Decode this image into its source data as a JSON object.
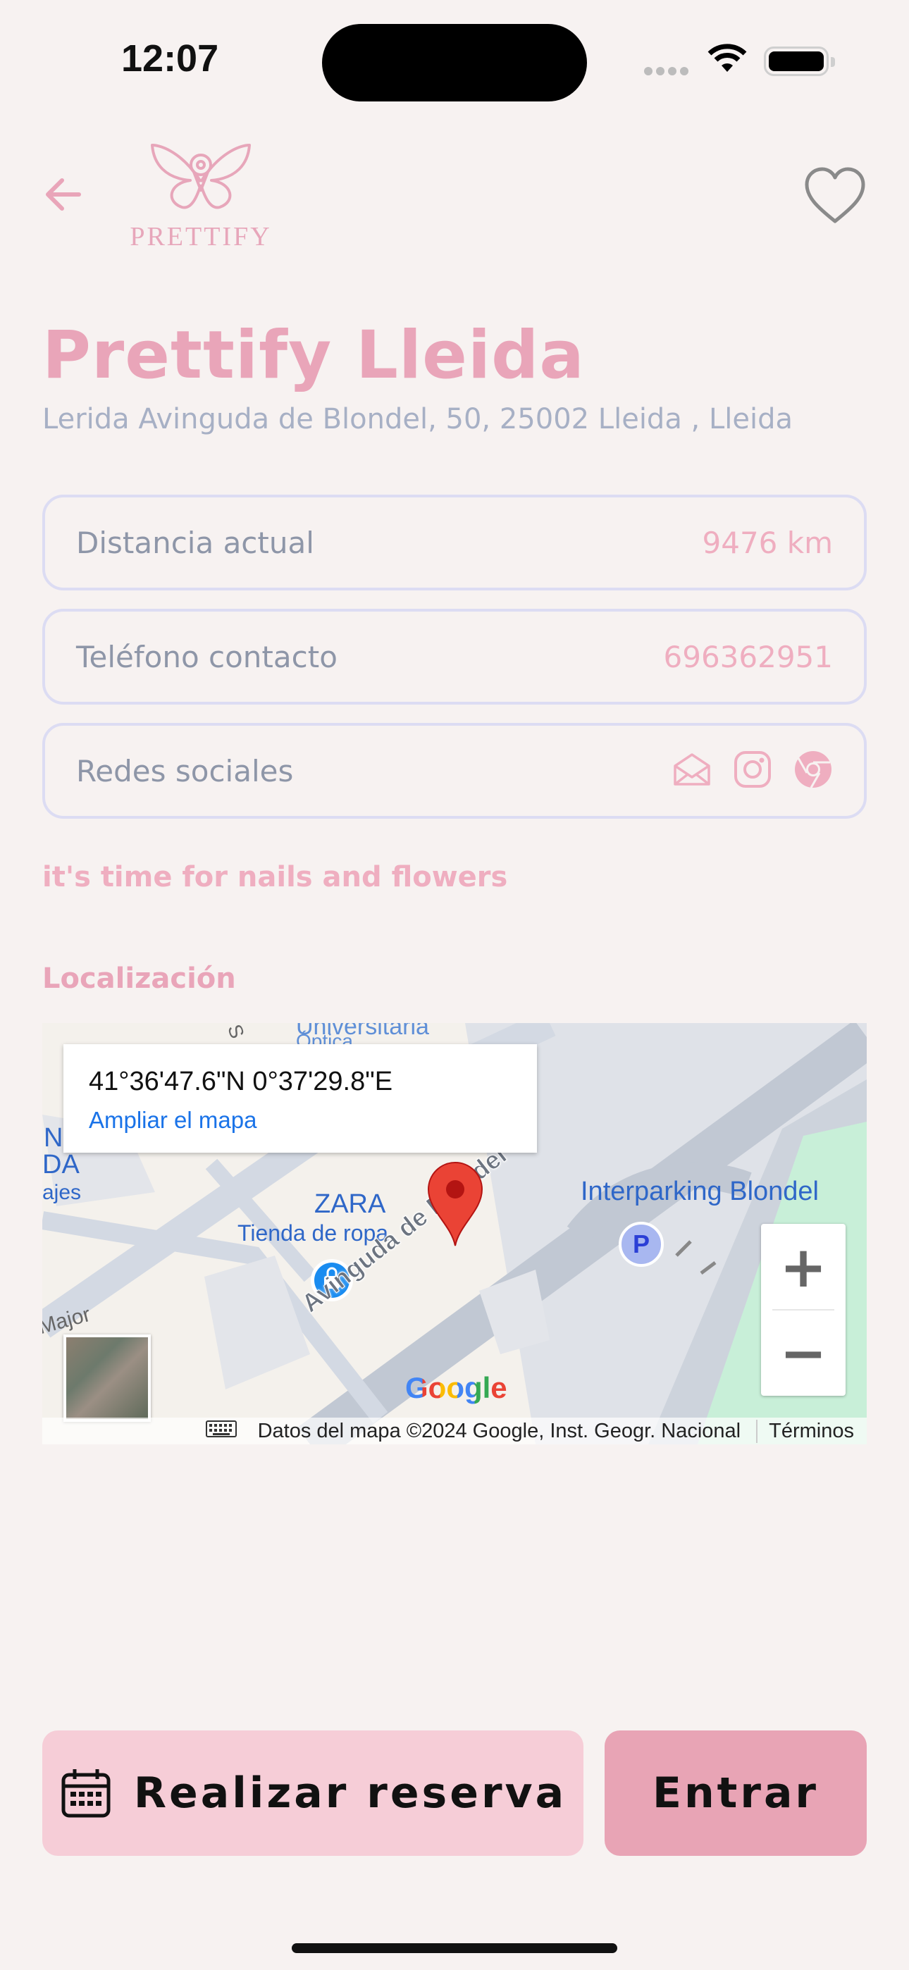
{
  "status_bar": {
    "time": "12:07"
  },
  "header": {
    "brand": "PRETTIFY"
  },
  "place": {
    "name": "Prettify Lleida",
    "address": "Lerida Avinguda de Blondel, 50, 25002 Lleida , Lleida"
  },
  "info": {
    "distance_label": "Distancia actual",
    "distance_value": "9476 km",
    "phone_label": "Teléfono contacto",
    "phone_value": "696362951",
    "social_label": "Redes sociales"
  },
  "tagline": "it's time for nails and flowers",
  "location_title": "Localización",
  "map": {
    "coords": "41°36'47.6\"N 0°37'29.8\"E",
    "enlarge_link": "Ampliar el mapa",
    "place_zara": "ZARA",
    "place_zara_sub": "Tienda de ropa",
    "place_parking": "Interparking Blondel",
    "street": "Avinguda de Blondel",
    "label_univ": "Universitària",
    "label_optica": "Óptica",
    "label_n": "N",
    "label_da": "DA",
    "label_ajes": "ajes",
    "label_major": "Major",
    "label_s": "S",
    "google": "Google",
    "attribution": "Datos del mapa ©2024 Google, Inst. Geogr. Nacional",
    "terms": "Términos",
    "zoom_in": "+",
    "zoom_out": "−",
    "parking_symbol": "P"
  },
  "buttons": {
    "reserve": "Realizar reserva",
    "enter": "Entrar"
  },
  "colors": {
    "brand_pink": "#e9a5b9",
    "light_pink": "#f6cdd7",
    "accent": "#e8a4b5"
  }
}
